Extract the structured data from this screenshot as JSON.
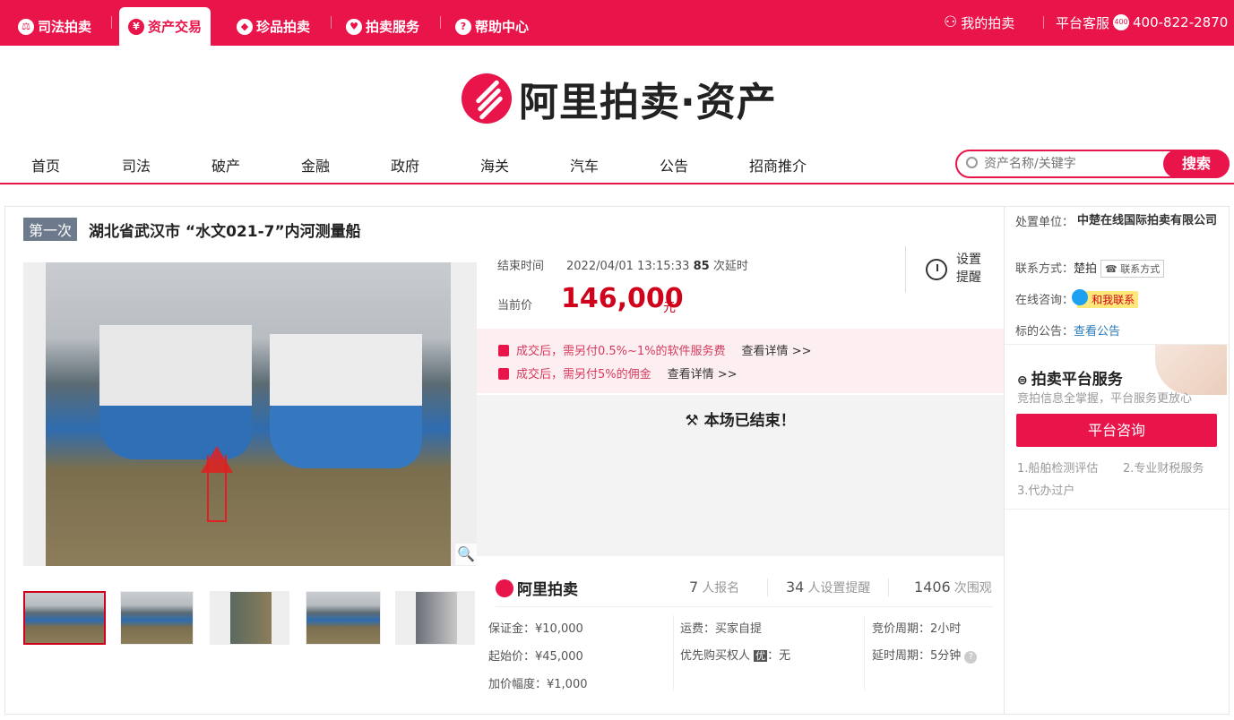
{
  "topnav": {
    "items": [
      {
        "label": "司法拍卖",
        "icon": "gavel-icon"
      },
      {
        "label": "资产交易",
        "icon": "asset-icon"
      },
      {
        "label": "珍品拍卖",
        "icon": "diamond-icon"
      },
      {
        "label": "拍卖服务",
        "icon": "heart-icon"
      },
      {
        "label": "帮助中心",
        "icon": "help-icon"
      }
    ],
    "my_auction": "我的拍卖",
    "service_label": "平台客服",
    "phone": "400-822-2870"
  },
  "brand": {
    "name": "阿里拍卖·资产"
  },
  "mainnav": {
    "items": [
      "首页",
      "司法",
      "破产",
      "金融",
      "政府",
      "海关",
      "汽车",
      "公告",
      "招商推介"
    ]
  },
  "search": {
    "placeholder": "资产名称/关键字",
    "button": "搜索"
  },
  "item": {
    "round": "第一次",
    "title": "湖北省武汉市 “水文021-7”内河测量船",
    "end_label": "结束时间",
    "end_time": "2022/04/01 13:15:33",
    "delay_count": "85",
    "delay_label": "次延时",
    "reminder": "设置提醒",
    "price_label": "当前价",
    "price": "146,000",
    "price_unit": "元",
    "fees": [
      {
        "text": "成交后，需另付0.5%~1%的软件服务费",
        "link": "查看详情 >>"
      },
      {
        "text": "成交后，需另付5%的佣金",
        "link": "查看详情 >>"
      }
    ],
    "ended": "本场已结束！"
  },
  "stats": {
    "brand": "阿里拍卖",
    "signups": "7",
    "signups_label": "人报名",
    "reminders": "34",
    "reminders_label": "人设置提醒",
    "views": "1406",
    "views_label": "次围观"
  },
  "details": {
    "deposit": "保证金：¥10,000",
    "start_price": "起始价：¥45,000",
    "increment": "加价幅度：¥1,000",
    "shipping": "运费：买家自提",
    "priority": "优先购买权人",
    "priority_badge": "优",
    "priority_value": "：无",
    "bid_cycle": "竞价周期：2小时",
    "delay_cycle": "延时周期：5分钟"
  },
  "sidebar": {
    "unit_label": "处置单位：",
    "unit_value": "中楚在线国际拍卖有限公司",
    "contact_label": "联系方式：",
    "contact_value": "楚拍",
    "contact_tag": "联系方式",
    "consult_label": "在线咨询：",
    "consult_value": "和我联系",
    "notice_label": "标的公告：",
    "notice_value": "查看公告",
    "svc_title": "拍卖平台服务",
    "svc_sub": "竞拍信息全掌握，平台服务更放心",
    "svc_button": "平台咨询",
    "svc_items": [
      "1.船舶检测评估",
      "2.专业财税服务",
      "3.代办过户"
    ]
  },
  "colors": {
    "brand": "#e8144a",
    "price": "#d0021b",
    "badge": "#6c7a8c"
  }
}
